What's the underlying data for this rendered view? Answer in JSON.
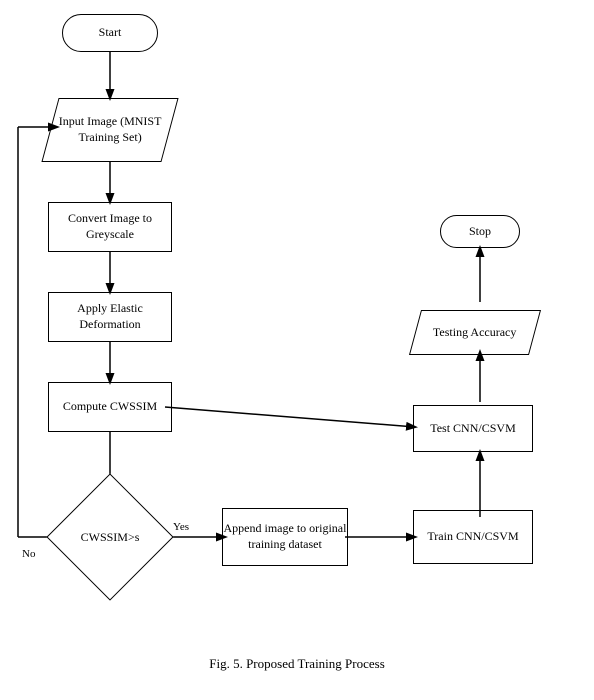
{
  "diagram": {
    "title": "Fig. 5. Proposed Training Process",
    "shapes": {
      "start": {
        "label": "Start"
      },
      "input_image": {
        "label": "Input Image (MNIST Training Set)"
      },
      "convert_greyscale": {
        "label": "Convert Image to Greyscale"
      },
      "apply_elastic": {
        "label": "Apply Elastic Deformation"
      },
      "compute_cwssim": {
        "label": "Compute CWSSIM"
      },
      "cwssim_decision": {
        "label": "CWSSIM>s"
      },
      "append_image": {
        "label": "Append image to original training dataset"
      },
      "train_cnn": {
        "label": "Train CNN/CSVM"
      },
      "test_cnn": {
        "label": "Test CNN/CSVM"
      },
      "testing_accuracy": {
        "label": "Testing Accuracy"
      },
      "stop": {
        "label": "Stop"
      }
    },
    "arrow_labels": {
      "yes": "Yes",
      "no": "No"
    }
  }
}
